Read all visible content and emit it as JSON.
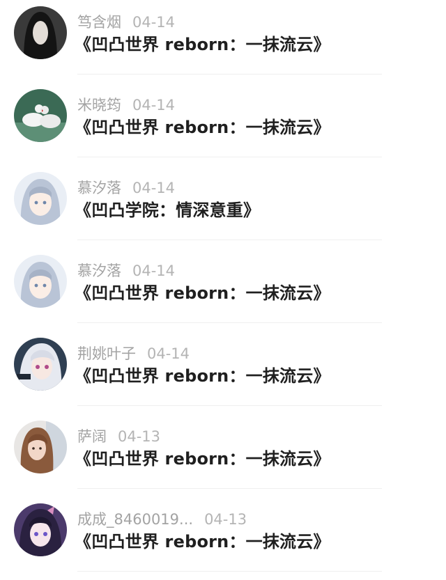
{
  "items": [
    {
      "user": "笃含烟",
      "date": "04-14",
      "title": "《凹凸世界 reborn：一抹流云》",
      "avatar_icon": "dark-haired-avatar-icon",
      "avatar_bg": "#3a3a3a"
    },
    {
      "user": "米晓筠",
      "date": "04-14",
      "title": "《凹凸世界 reborn：一抹流云》",
      "avatar_icon": "white-doves-avatar-icon",
      "avatar_bg": "#3b6a55"
    },
    {
      "user": "慕汐落",
      "date": "04-14",
      "title": "《凹凸学院：情深意重》",
      "avatar_icon": "anime-girl-avatar-icon",
      "avatar_bg": "#e9eef5"
    },
    {
      "user": "慕汐落",
      "date": "04-14",
      "title": "《凹凸世界 reborn：一抹流云》",
      "avatar_icon": "anime-girl-avatar-icon",
      "avatar_bg": "#e9eef5"
    },
    {
      "user": "荆姚叶子",
      "date": "04-14",
      "title": "《凹凸世界 reborn：一抹流云》",
      "avatar_icon": "anime-character-avatar-icon",
      "avatar_bg": "#2f3f52"
    },
    {
      "user": "萨阔",
      "date": "04-13",
      "title": "《凹凸世界 reborn：一抹流云》",
      "avatar_icon": "photo-girl-avatar-icon",
      "avatar_bg": "#c9a48a"
    },
    {
      "user": "成成_8460019...",
      "date": "04-13",
      "title": "《凹凸世界 reborn：一抹流云》",
      "avatar_icon": "anime-purple-avatar-icon",
      "avatar_bg": "#4b3a6b"
    }
  ]
}
